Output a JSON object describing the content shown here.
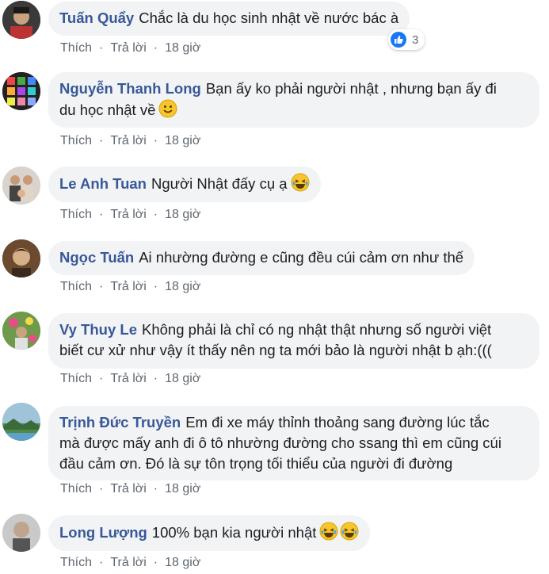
{
  "colors": {
    "author": "#385898",
    "bubble": "#f2f3f5",
    "meta": "#606770",
    "like_blue": "#1877f2"
  },
  "actions": {
    "like": "Thích",
    "reply": "Trả lời",
    "separator": "·"
  },
  "comments": [
    {
      "author": "Tuấn Quẩy",
      "text": "Chắc là du học sinh nhật về nước bác à",
      "time": "18 giờ",
      "reactions": "3",
      "avatar_icon": "person-avatar"
    },
    {
      "author": "Nguyễn Thanh Long",
      "text_line1": "Bạn ấy ko phải người nhật , nhưng bạn ấy đi",
      "text_line2": "du học nhật về",
      "emoji": "smile-emoji",
      "time": "18 giờ",
      "avatar_icon": "phone-apps-avatar"
    },
    {
      "author": "Le Anh Tuan",
      "text": "Người Nhật đấy cụ ạ",
      "emoji": "laugh-emoji",
      "time": "18 giờ",
      "avatar_icon": "family-avatar"
    },
    {
      "author": "Ngọc Tuấn",
      "text": "Ai nhường đường e cũng đều cúi cảm ơn như thế",
      "time": "18 giờ",
      "avatar_icon": "person-avatar"
    },
    {
      "author": "Vy Thuy Le",
      "text_line1": "Không phải là chỉ có ng nhật thật nhưng số người việt",
      "text_line2": "biết cư xử như vậy ít thấy nên ng ta mới bảo là người nhật b ạh:(((",
      "time": "18 giờ",
      "avatar_icon": "flowers-avatar"
    },
    {
      "author": "Trịnh Đức Truyền",
      "text_line1": "Em đi xe máy thỉnh thoảng sang đường lúc tắc",
      "text_line2": "mà được mấy anh đi ô tô nhường đường cho ssang thì em cũng cúi",
      "text_line3": "đầu cảm ơn. Đó là sự tôn trọng tối thiểu của người đi đường",
      "time": "18 giờ",
      "avatar_icon": "landscape-avatar"
    },
    {
      "author": "Long Lượng",
      "text": "100% bạn kia người nhật",
      "emoji": "laugh-emoji",
      "time": "18 giờ",
      "avatar_icon": "person-avatar"
    }
  ]
}
